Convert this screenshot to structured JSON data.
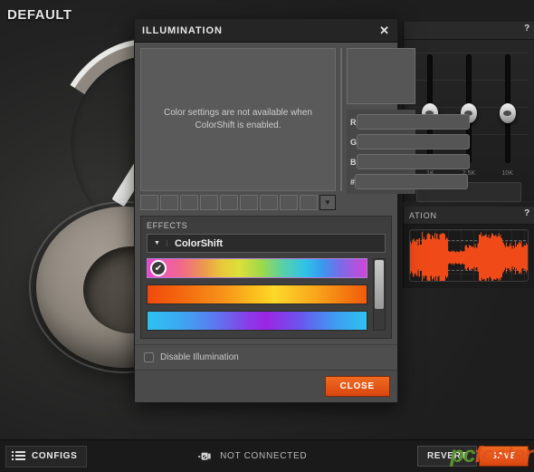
{
  "app": {
    "preset_title": "DEFAULT"
  },
  "eq_panel": {
    "help": "?",
    "bands": [
      {
        "label": "1K"
      },
      {
        "label": "2.5K"
      },
      {
        "label": "10K"
      }
    ]
  },
  "voice_panel": {
    "title": "ATION",
    "help": "?"
  },
  "modal": {
    "title": "ILLUMINATION",
    "close_icon": "✕",
    "picker": {
      "message": "Color settings are not available when ColorShift is enabled.",
      "swatch_count": 9,
      "dropdown_icon": "▼"
    },
    "fields": [
      {
        "label": "R",
        "value": "",
        "placeholder": ""
      },
      {
        "label": "G",
        "value": "",
        "placeholder": ""
      },
      {
        "label": "B",
        "value": "",
        "placeholder": ""
      },
      {
        "label": "#",
        "value": "",
        "placeholder": ""
      }
    ],
    "effects": {
      "section_label": "EFFECTS",
      "combo_arrow": "▼",
      "selected_effect": "ColorShift",
      "gradients": [
        {
          "name": "rainbow-magenta",
          "selected": true,
          "check_icon": "✔",
          "css": "linear-gradient(90deg,#e845c8 0%,#f25ab0 8%,#f06a86 16%,#eb9a4d 26%,#e8c93a 34%,#dbe03a 42%,#9fd94a 52%,#57cfa8 62%,#2fc3e8 72%,#3a97ee 80%,#7b6ae8 88%,#d145d6 100%)"
        },
        {
          "name": "orange-yellow",
          "selected": false,
          "check_icon": "",
          "css": "linear-gradient(90deg,#f04a0c 0%,#f4690f 16%,#f7911a 34%,#fbc21e 50%,#fdd92a 58%,#f9a81c 76%,#f4740f 92%,#f05a0c 100%)"
        },
        {
          "name": "cyan-purple",
          "selected": false,
          "check_icon": "",
          "css": "linear-gradient(90deg,#2ec2f0 0%,#3aaaf2 14%,#5a7cf0 30%,#8a3ce8 46%,#9b25e4 54%,#6a57ee 70%,#3e9df2 86%,#2ec2f0 100%)"
        }
      ]
    },
    "disable_checkbox_label": "Disable Illumination",
    "close_button": "CLOSE"
  },
  "bottom_bar": {
    "configs_label": "CONFIGS",
    "status_text": "NOT CONNECTED",
    "revert_label": "REVERT",
    "save_label": "SAVE"
  },
  "watermark": {
    "part_a": "pc",
    "part_b": "foster"
  }
}
